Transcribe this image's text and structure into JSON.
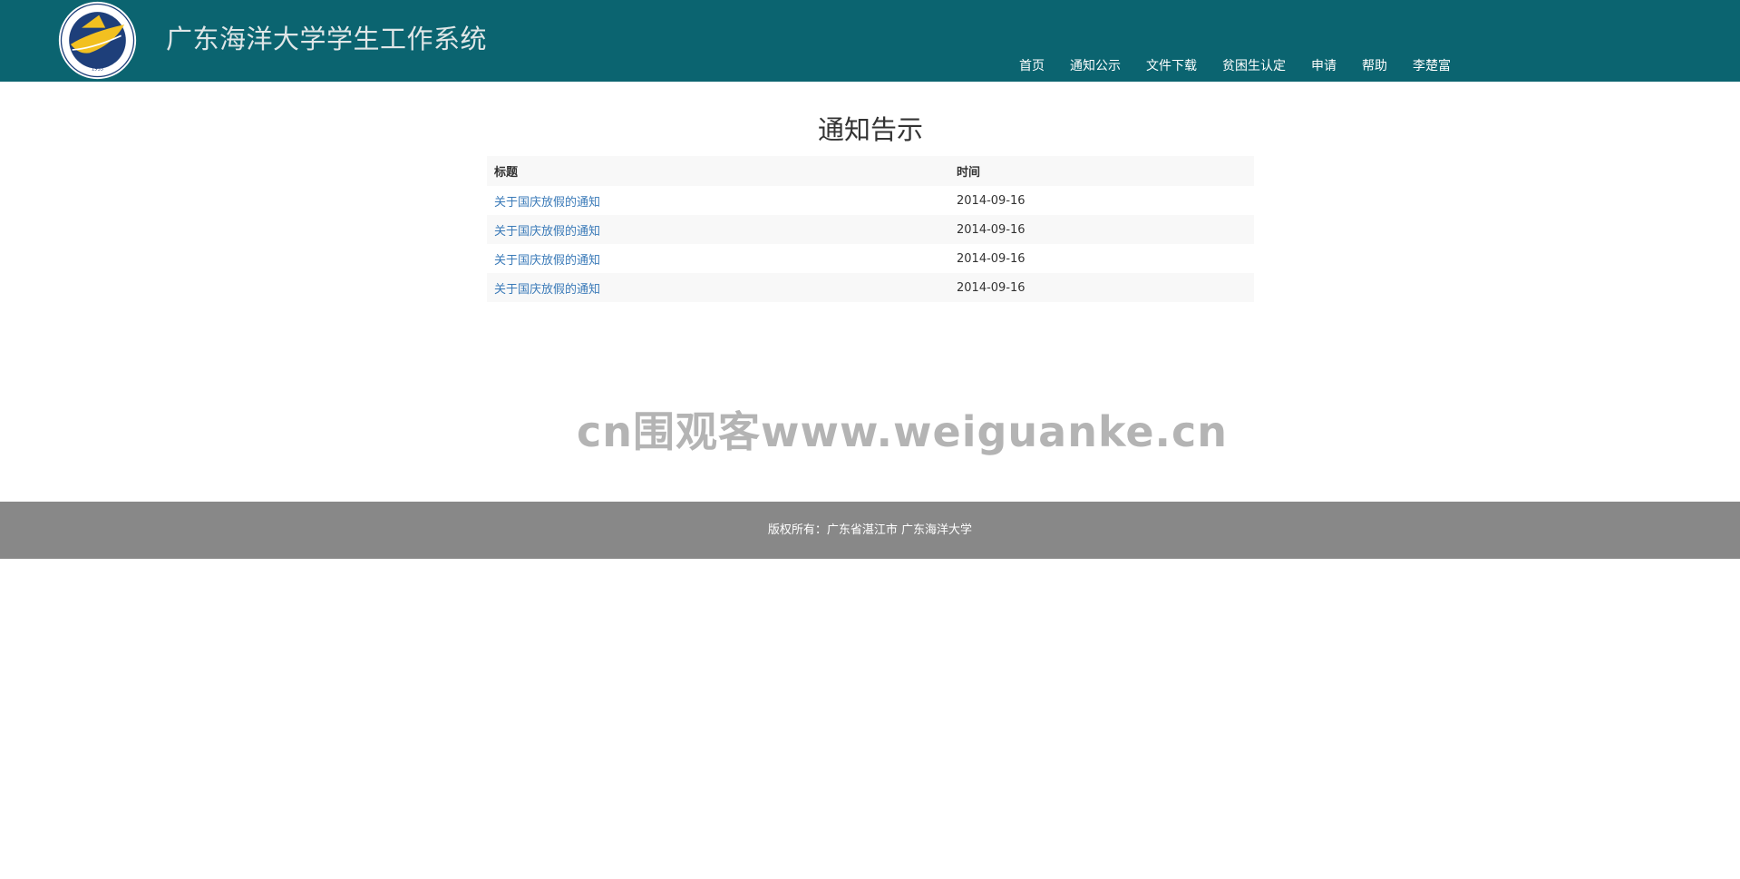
{
  "header": {
    "site_title": "广东海洋大学学生工作系统",
    "logo_icon": "university-seal-icon",
    "colors": {
      "background": "#0b6470",
      "title": "#dfe6e7"
    }
  },
  "nav": {
    "items": [
      {
        "label": "首页"
      },
      {
        "label": "通知公示"
      },
      {
        "label": "文件下载"
      },
      {
        "label": "贫困生认定"
      },
      {
        "label": "申请"
      },
      {
        "label": "帮助"
      },
      {
        "label": "李楚富"
      }
    ]
  },
  "main": {
    "page_title": "通知告示",
    "table": {
      "headers": {
        "title": "标题",
        "time": "时间"
      },
      "rows": [
        {
          "title": "关于国庆放假的通知",
          "time": "2014-09-16"
        },
        {
          "title": "关于国庆放假的通知",
          "time": "2014-09-16"
        },
        {
          "title": "关于国庆放假的通知",
          "time": "2014-09-16"
        },
        {
          "title": "关于国庆放假的通知",
          "time": "2014-09-16"
        }
      ]
    },
    "link_color": "#3a7ab8"
  },
  "watermark": {
    "text": "cn围观客www.weiguanke.cn"
  },
  "footer": {
    "text": "版权所有：广东省湛江市   广东海洋大学",
    "background": "#888888"
  }
}
